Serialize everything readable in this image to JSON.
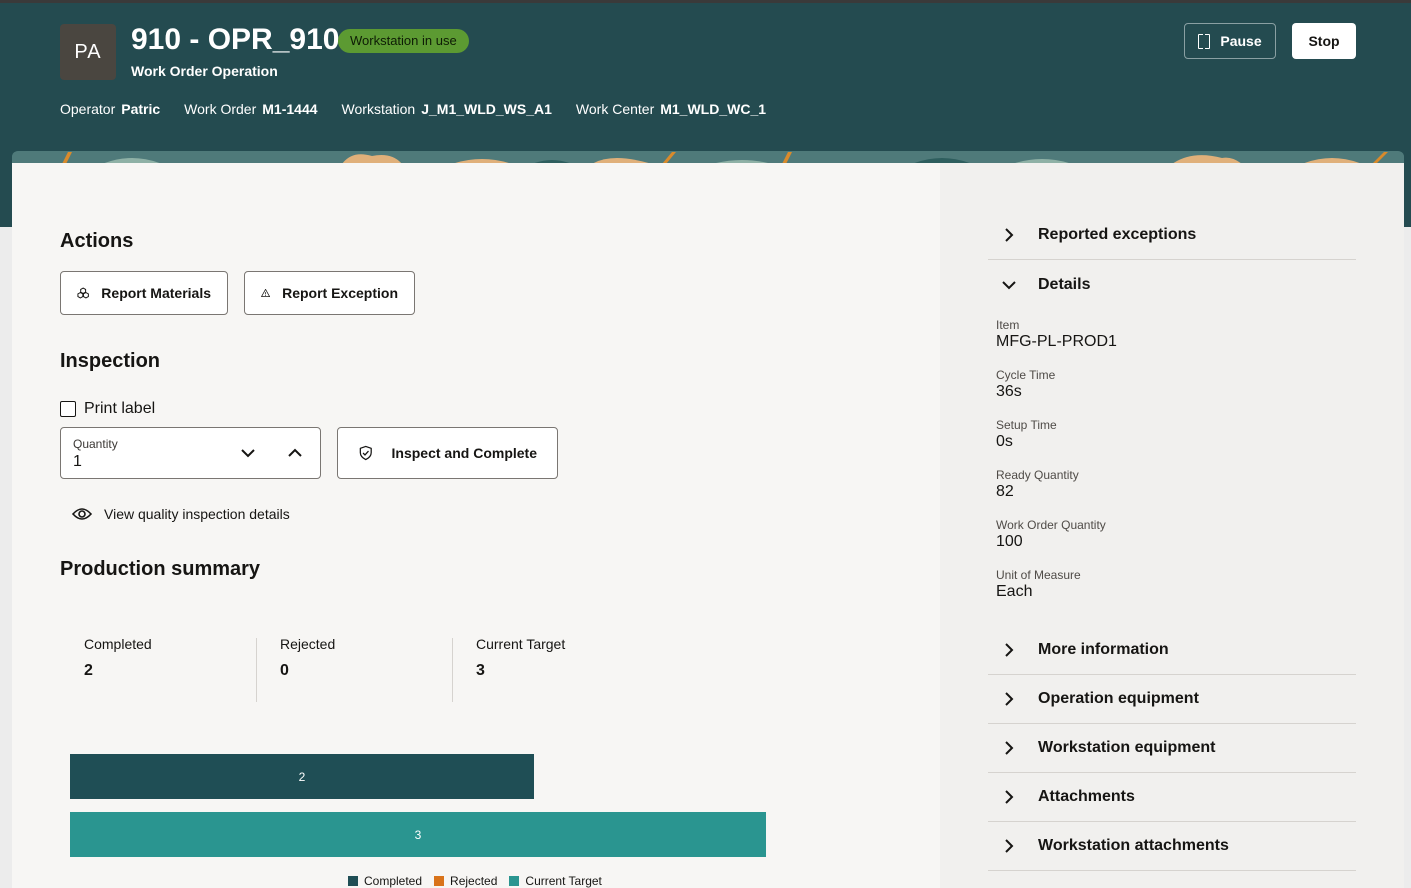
{
  "header": {
    "avatar_initials": "PA",
    "title": "910 - OPR_910",
    "status_badge": "Workstation in use",
    "subtitle": "Work Order Operation",
    "meta": [
      {
        "label": "Operator",
        "value": "Patric"
      },
      {
        "label": "Work Order",
        "value": "M1-1444"
      },
      {
        "label": "Workstation",
        "value": "J_M1_WLD_WS_A1"
      },
      {
        "label": "Work Center",
        "value": "M1_WLD_WC_1"
      }
    ],
    "pause_label": "Pause",
    "stop_label": "Stop"
  },
  "actions": {
    "heading": "Actions",
    "report_materials": "Report Materials",
    "report_exception": "Report Exception"
  },
  "inspection": {
    "heading": "Inspection",
    "print_label": "Print label",
    "print_label_checked": false,
    "quantity_label": "Quantity",
    "quantity_value": "1",
    "inspect_complete": "Inspect and Complete",
    "view_details": "View quality inspection details"
  },
  "production_summary": {
    "heading": "Production summary",
    "stats": [
      {
        "label": "Completed",
        "value": "2"
      },
      {
        "label": "Rejected",
        "value": "0"
      },
      {
        "label": "Current Target",
        "value": "3"
      }
    ]
  },
  "chart_data": {
    "type": "bar",
    "orientation": "horizontal",
    "categories": [
      "Completed",
      "Current Target"
    ],
    "series": [
      {
        "name": "Completed",
        "values": [
          2
        ],
        "color": "#1f4e55"
      },
      {
        "name": "Rejected",
        "values": [
          0
        ],
        "color": "#d9731a"
      },
      {
        "name": "Current Target",
        "values": [
          3
        ],
        "color": "#2a9590"
      }
    ],
    "bars": [
      {
        "series": "Completed",
        "value": 2,
        "label": "2"
      },
      {
        "series": "Current Target",
        "value": 3,
        "label": "3"
      }
    ],
    "legend": [
      "Completed",
      "Rejected",
      "Current Target"
    ],
    "legend_position": "bottom"
  },
  "sidebar": {
    "reported_exceptions": "Reported exceptions",
    "details_heading": "Details",
    "details": [
      {
        "label": "Item",
        "value": "MFG-PL-PROD1"
      },
      {
        "label": "Cycle Time",
        "value": "36s"
      },
      {
        "label": "Setup Time",
        "value": "0s"
      },
      {
        "label": "Ready Quantity",
        "value": "82"
      },
      {
        "label": "Work Order Quantity",
        "value": "100"
      },
      {
        "label": "Unit of Measure",
        "value": "Each"
      }
    ],
    "sections": [
      "More information",
      "Operation equipment",
      "Workstation equipment",
      "Attachments",
      "Workstation attachments"
    ]
  },
  "colors": {
    "header_bg": "#244b50",
    "badge": "#5c9a32",
    "bar_completed": "#1f4e55",
    "bar_rejected": "#d9731a",
    "bar_target": "#2a9590"
  }
}
